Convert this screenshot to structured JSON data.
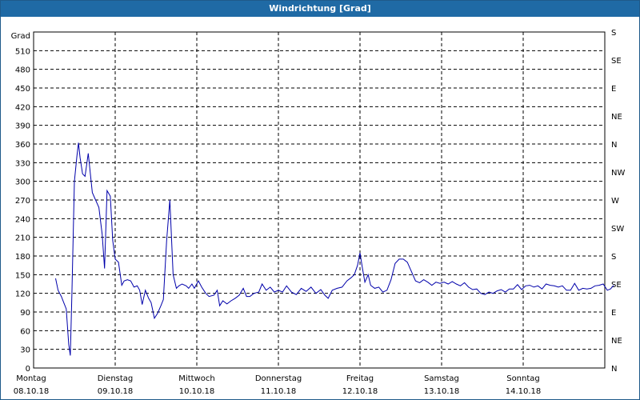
{
  "window": {
    "title": "Windrichtung [Grad]"
  },
  "chart_data": {
    "type": "line",
    "title": "Windrichtung [Grad]",
    "ylabel": "Grad",
    "ylim": [
      0,
      540
    ],
    "yticks": [
      0,
      30,
      60,
      90,
      120,
      150,
      180,
      210,
      240,
      270,
      300,
      330,
      360,
      390,
      420,
      450,
      480,
      510
    ],
    "right_axis": {
      "labels": [
        "N",
        "NE",
        "E",
        "SE",
        "S",
        "SW",
        "W",
        "NW",
        "N",
        "NE",
        "E",
        "SE",
        "S"
      ]
    },
    "x_axis": {
      "days": [
        {
          "day": "Montag",
          "date": "08.10.18"
        },
        {
          "day": "Dienstag",
          "date": "09.10.18"
        },
        {
          "day": "Mittwoch",
          "date": "10.10.18"
        },
        {
          "day": "Donnerstag",
          "date": "11.10.18"
        },
        {
          "day": "Freitag",
          "date": "12.10.18"
        },
        {
          "day": "Samstag",
          "date": "13.10.18"
        },
        {
          "day": "Sonntag",
          "date": "14.10.18"
        }
      ],
      "range_days": [
        0,
        7
      ]
    },
    "grid": true,
    "series": [
      {
        "line_color": "#0000aa",
        "x_unit": "days since 08.10.18 00:00",
        "points": [
          [
            0.27,
            144
          ],
          [
            0.3,
            125
          ],
          [
            0.34,
            115
          ],
          [
            0.37,
            105
          ],
          [
            0.4,
            95
          ],
          [
            0.43,
            38
          ],
          [
            0.45,
            20
          ],
          [
            0.47,
            120
          ],
          [
            0.5,
            300
          ],
          [
            0.53,
            340
          ],
          [
            0.55,
            362
          ],
          [
            0.57,
            338
          ],
          [
            0.6,
            312
          ],
          [
            0.63,
            308
          ],
          [
            0.67,
            345
          ],
          [
            0.72,
            282
          ],
          [
            0.76,
            270
          ],
          [
            0.8,
            258
          ],
          [
            0.84,
            215
          ],
          [
            0.87,
            160
          ],
          [
            0.9,
            285
          ],
          [
            0.94,
            276
          ],
          [
            0.97,
            205
          ],
          [
            1.0,
            175
          ],
          [
            1.04,
            170
          ],
          [
            1.08,
            133
          ],
          [
            1.11,
            140
          ],
          [
            1.15,
            142
          ],
          [
            1.19,
            140
          ],
          [
            1.23,
            130
          ],
          [
            1.27,
            132
          ],
          [
            1.3,
            125
          ],
          [
            1.33,
            102
          ],
          [
            1.37,
            125
          ],
          [
            1.41,
            112
          ],
          [
            1.44,
            105
          ],
          [
            1.48,
            80
          ],
          [
            1.52,
            88
          ],
          [
            1.56,
            100
          ],
          [
            1.59,
            110
          ],
          [
            1.63,
            205
          ],
          [
            1.67,
            270
          ],
          [
            1.71,
            150
          ],
          [
            1.75,
            128
          ],
          [
            1.78,
            132
          ],
          [
            1.82,
            135
          ],
          [
            1.87,
            132
          ],
          [
            1.9,
            128
          ],
          [
            1.94,
            135
          ],
          [
            1.97,
            128
          ],
          [
            2.02,
            140
          ],
          [
            2.06,
            130
          ],
          [
            2.11,
            120
          ],
          [
            2.15,
            115
          ],
          [
            2.21,
            117
          ],
          [
            2.25,
            125
          ],
          [
            2.28,
            100
          ],
          [
            2.32,
            108
          ],
          [
            2.37,
            103
          ],
          [
            2.42,
            108
          ],
          [
            2.47,
            112
          ],
          [
            2.52,
            117
          ],
          [
            2.57,
            128
          ],
          [
            2.61,
            115
          ],
          [
            2.65,
            115
          ],
          [
            2.7,
            120
          ],
          [
            2.76,
            122
          ],
          [
            2.8,
            135
          ],
          [
            2.85,
            125
          ],
          [
            2.9,
            130
          ],
          [
            2.95,
            122
          ],
          [
            3.0,
            125
          ],
          [
            3.05,
            122
          ],
          [
            3.1,
            132
          ],
          [
            3.16,
            122
          ],
          [
            3.22,
            118
          ],
          [
            3.28,
            128
          ],
          [
            3.34,
            123
          ],
          [
            3.4,
            130
          ],
          [
            3.46,
            120
          ],
          [
            3.52,
            126
          ],
          [
            3.57,
            117
          ],
          [
            3.61,
            112
          ],
          [
            3.66,
            125
          ],
          [
            3.72,
            128
          ],
          [
            3.78,
            130
          ],
          [
            3.84,
            140
          ],
          [
            3.89,
            145
          ],
          [
            3.93,
            150
          ],
          [
            3.97,
            165
          ],
          [
            4.0,
            185
          ],
          [
            4.03,
            160
          ],
          [
            4.06,
            138
          ],
          [
            4.1,
            150
          ],
          [
            4.13,
            133
          ],
          [
            4.18,
            128
          ],
          [
            4.23,
            130
          ],
          [
            4.28,
            122
          ],
          [
            4.33,
            125
          ],
          [
            4.38,
            142
          ],
          [
            4.43,
            168
          ],
          [
            4.48,
            175
          ],
          [
            4.53,
            175
          ],
          [
            4.58,
            170
          ],
          [
            4.63,
            155
          ],
          [
            4.68,
            140
          ],
          [
            4.73,
            137
          ],
          [
            4.78,
            142
          ],
          [
            4.83,
            138
          ],
          [
            4.88,
            133
          ],
          [
            4.93,
            138
          ],
          [
            4.98,
            136
          ],
          [
            5.03,
            138
          ],
          [
            5.08,
            135
          ],
          [
            5.13,
            139
          ],
          [
            5.18,
            135
          ],
          [
            5.23,
            132
          ],
          [
            5.28,
            137
          ],
          [
            5.33,
            130
          ],
          [
            5.38,
            126
          ],
          [
            5.43,
            127
          ],
          [
            5.48,
            120
          ],
          [
            5.53,
            118
          ],
          [
            5.58,
            122
          ],
          [
            5.63,
            120
          ],
          [
            5.68,
            124
          ],
          [
            5.73,
            126
          ],
          [
            5.78,
            122
          ],
          [
            5.83,
            127
          ],
          [
            5.88,
            127
          ],
          [
            5.93,
            134
          ],
          [
            5.98,
            126
          ],
          [
            6.03,
            132
          ],
          [
            6.08,
            133
          ],
          [
            6.13,
            130
          ],
          [
            6.18,
            132
          ],
          [
            6.23,
            127
          ],
          [
            6.28,
            135
          ],
          [
            6.33,
            133
          ],
          [
            6.38,
            132
          ],
          [
            6.43,
            130
          ],
          [
            6.48,
            132
          ],
          [
            6.53,
            125
          ],
          [
            6.58,
            125
          ],
          [
            6.63,
            136
          ],
          [
            6.68,
            125
          ],
          [
            6.73,
            128
          ],
          [
            6.78,
            127
          ],
          [
            6.83,
            128
          ],
          [
            6.88,
            132
          ],
          [
            6.93,
            133
          ],
          [
            6.98,
            135
          ],
          [
            7.03,
            125
          ],
          [
            7.07,
            127
          ],
          [
            7.11,
            133
          ]
        ]
      }
    ]
  }
}
